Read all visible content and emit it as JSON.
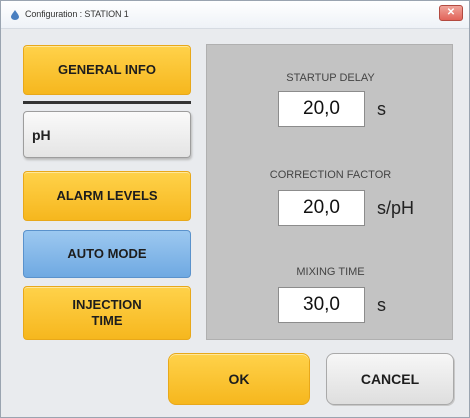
{
  "window": {
    "title": "Configuration : STATION 1",
    "close_label": "✕"
  },
  "sidebar": {
    "general_info": "GENERAL INFO",
    "ph_label": "pH",
    "alarm_levels": "ALARM LEVELS",
    "auto_mode": "AUTO MODE",
    "injection_time_line1": "INJECTION",
    "injection_time_line2": "TIME"
  },
  "settings": {
    "startup_delay": {
      "label": "STARTUP DELAY",
      "value": "20,0",
      "unit": "s"
    },
    "correction_factor": {
      "label": "CORRECTION FACTOR",
      "value": "20,0",
      "unit": "s/pH"
    },
    "mixing_time": {
      "label": "MIXING TIME",
      "value": "30,0",
      "unit": "s"
    }
  },
  "footer": {
    "ok_label": "OK",
    "cancel_label": "CANCEL"
  },
  "colors": {
    "accent_yellow": "#f6b71e",
    "active_blue": "#6fa9e2",
    "panel_gray": "#c3c3c3"
  }
}
